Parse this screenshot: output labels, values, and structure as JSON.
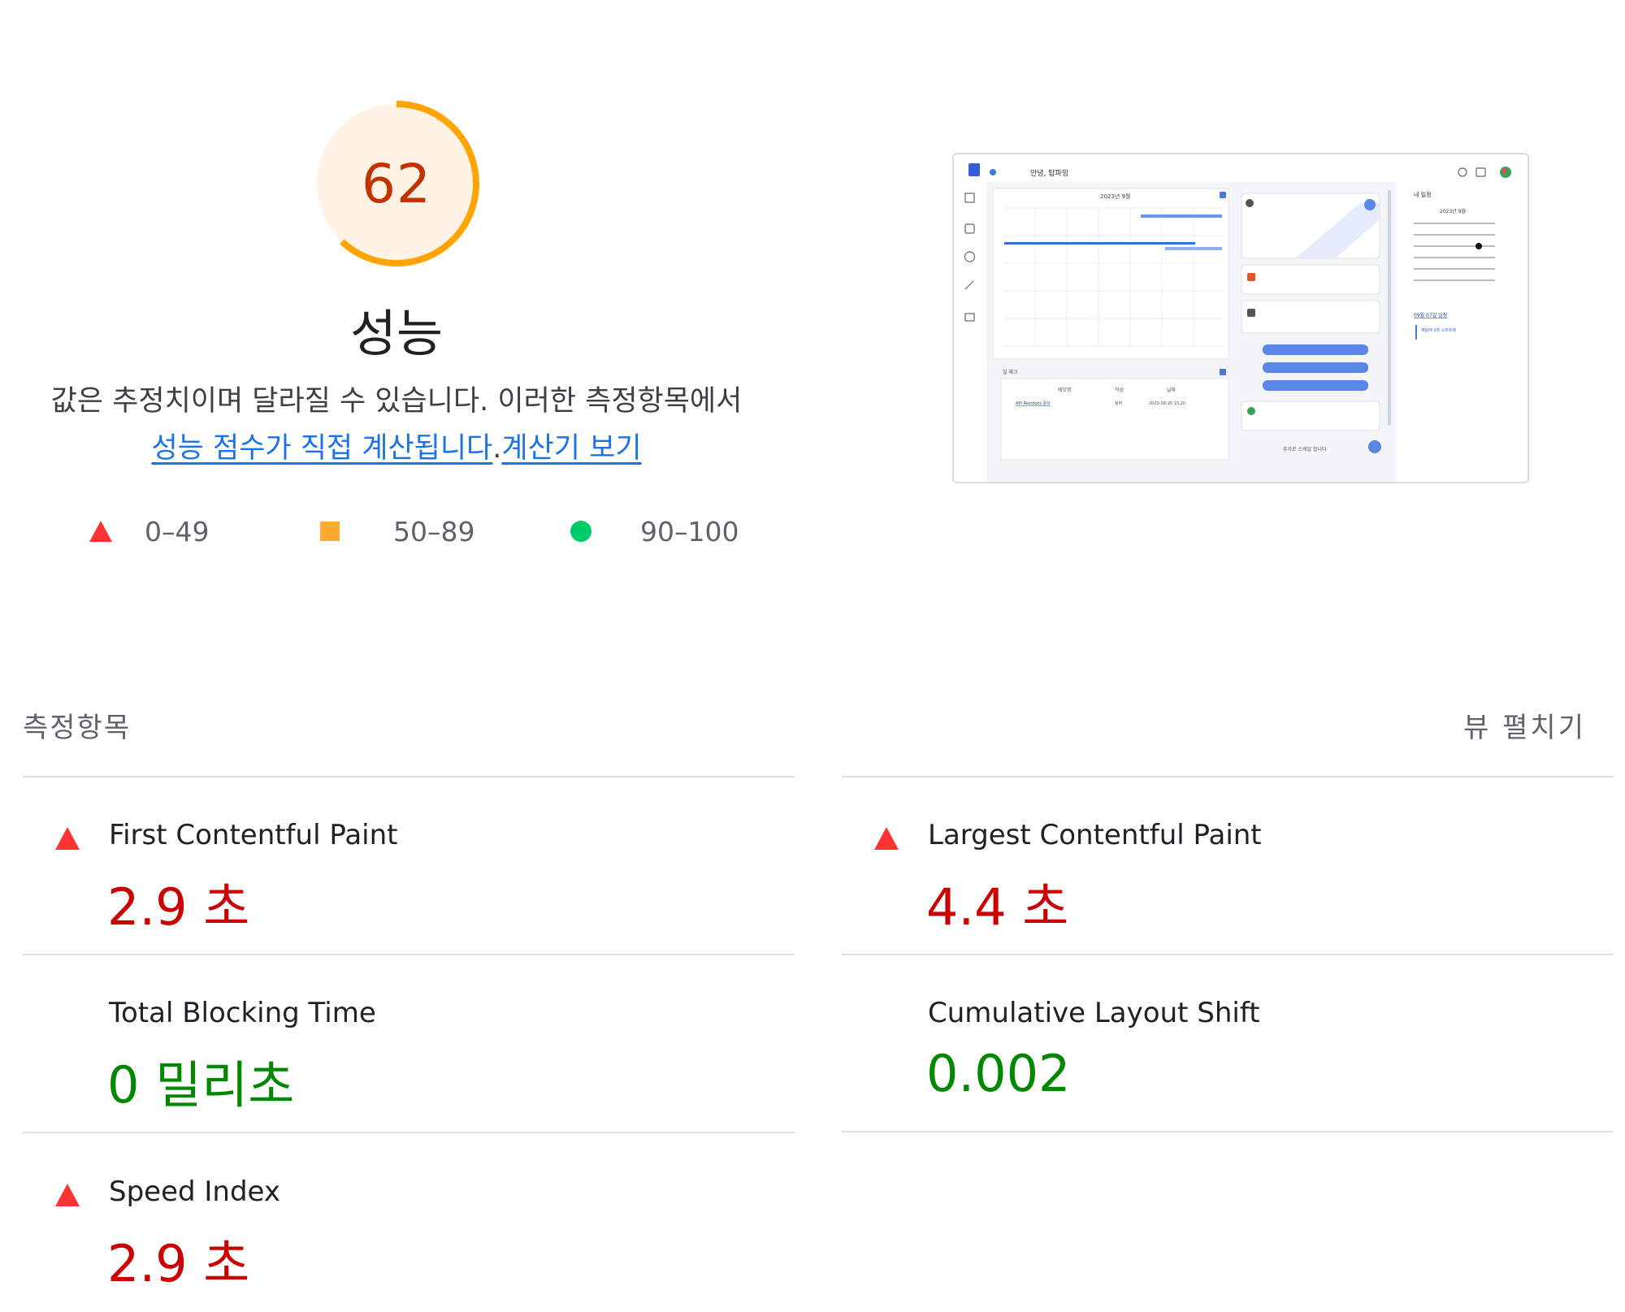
{
  "score": {
    "value": 62,
    "fraction": 0.62,
    "category": "성능",
    "ring_color": "#ffa400",
    "fill_color": "#fff3e6",
    "text_color": "#c33300"
  },
  "description": {
    "text": "값은 추정치이며 달라질 수 있습니다. 이러한 측정항목에서",
    "link1": "성능 점수가 직접 계산됩니다",
    "separator": ".",
    "link2": "계산기 보기"
  },
  "legend": [
    {
      "range": "0–49",
      "shape": "triangle",
      "color": "#ff3333"
    },
    {
      "range": "50–89",
      "shape": "square",
      "color": "#ffaa33"
    },
    {
      "range": "90–100",
      "shape": "circle",
      "color": "#00cc66"
    }
  ],
  "thumbnail": {
    "greeting": "안녕, 탑파밍",
    "calendar_month": "2023년 9월",
    "mini_calendar_month": "2023년 9월",
    "side_title": "내 일정",
    "schedule_label": "09월 07일 일정",
    "schedule_item": "채팅에 9월 소프트웨",
    "table_section": "일 체크",
    "table_headers": [
      "메모명",
      "작성",
      "날짜"
    ],
    "table_row": [
      "API Restdocs 문서",
      "탐바",
      "2023-08-25 15:20"
    ],
    "chat_footer": "추가로 스케일 합니다"
  },
  "metrics_section": {
    "title": "측정항목",
    "expand_label": "뷰 펼치기"
  },
  "metrics": [
    {
      "id": "fcp",
      "name": "First Contentful Paint",
      "value": "2.9 초",
      "status": "fail"
    },
    {
      "id": "lcp",
      "name": "Largest Contentful Paint",
      "value": "4.4 초",
      "status": "fail"
    },
    {
      "id": "tbt",
      "name": "Total Blocking Time",
      "value": "0 밀리초",
      "status": "pass"
    },
    {
      "id": "cls",
      "name": "Cumulative Layout Shift",
      "value": "0.002",
      "status": "pass"
    },
    {
      "id": "si",
      "name": "Speed Index",
      "value": "2.9 초",
      "status": "fail"
    }
  ],
  "colors": {
    "fail": "#cc0000",
    "pass": "#008800",
    "link": "#1a73e8"
  }
}
